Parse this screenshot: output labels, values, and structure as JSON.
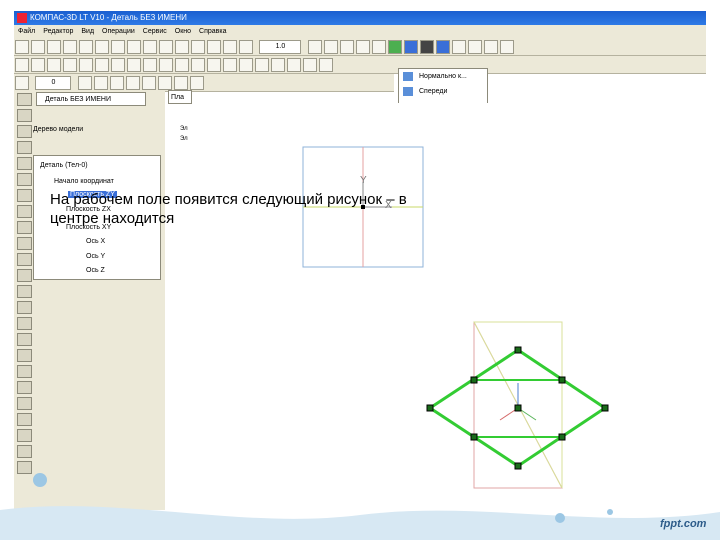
{
  "window": {
    "title": "КОМПАС-3D LT V10 - Деталь БЕЗ ИМЕНИ"
  },
  "menu": [
    "Файл",
    "Редактор",
    "Вид",
    "Операции",
    "Сервис",
    "Окно",
    "Справка"
  ],
  "toolbar": {
    "scale_value": "1.0",
    "style_value": "0"
  },
  "view_dropdown": {
    "items": [
      "Нормально к...",
      "Спереди"
    ]
  },
  "tree_panel": {
    "tab_label": "Деталь БЕЗ ИМЕНИ",
    "second_tab": "Пла",
    "header": "Дерево модели",
    "items": [
      "Деталь (Тел-0)",
      "Начало координат",
      "Плоскость ZX",
      "Плоскость ZY",
      "Плоскость XY",
      "Ось X",
      "Ось Y",
      "Ось Z"
    ]
  },
  "partial_labels": [
    "Эл",
    "Эл",
    "Эл"
  ],
  "caption": {
    "line1": "На рабочем поле появится следующий рисунок – в",
    "line2": "центре находится"
  },
  "drawing": {
    "axis_x_label": "X",
    "axis_y_label": "Y",
    "frame_color": "#8fb3d9",
    "outline_color": "#33cc33"
  },
  "watermark": "fppt.com",
  "colors": {
    "title_bar": "#2e7ae6",
    "panel": "#ece9d8",
    "selection": "#3a6fd8"
  }
}
